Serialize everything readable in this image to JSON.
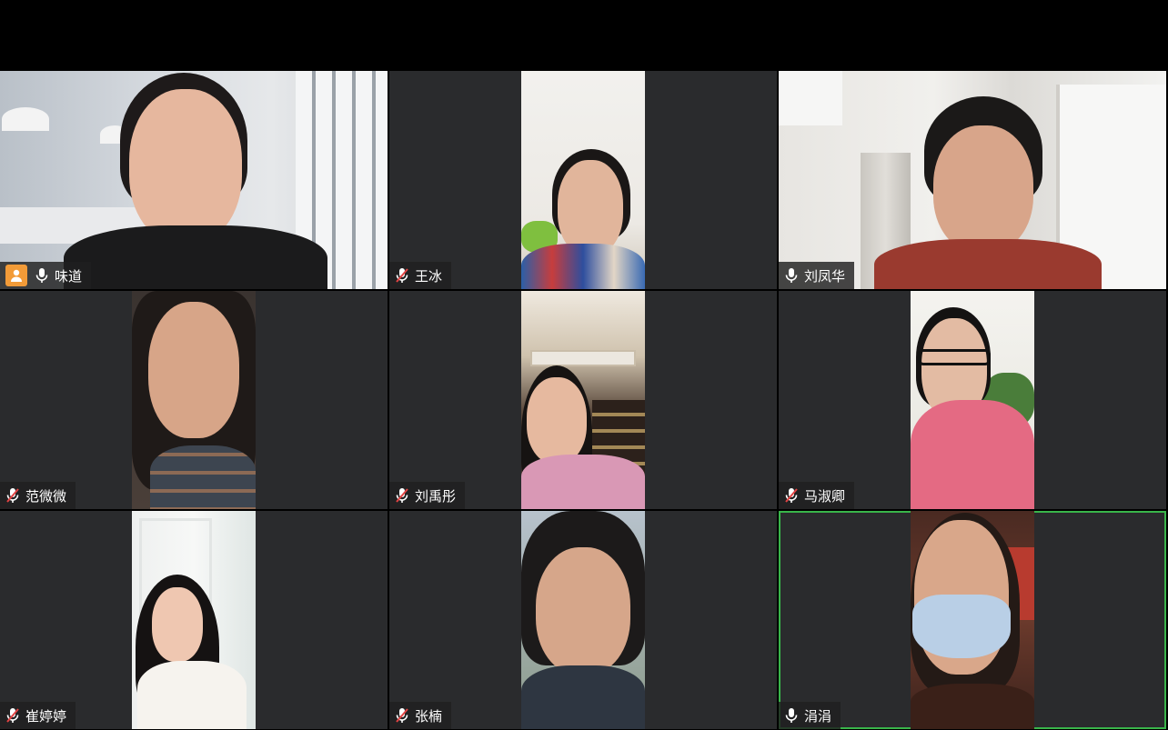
{
  "meeting": {
    "participants": [
      {
        "name": "味道",
        "muted": false,
        "host": true,
        "active": false
      },
      {
        "name": "王冰",
        "muted": true,
        "host": false,
        "active": false
      },
      {
        "name": "刘凤华",
        "muted": false,
        "host": false,
        "active": false
      },
      {
        "name": "范微微",
        "muted": true,
        "host": false,
        "active": false
      },
      {
        "name": "刘禹彤",
        "muted": true,
        "host": false,
        "active": false
      },
      {
        "name": "马淑卿",
        "muted": true,
        "host": false,
        "active": false
      },
      {
        "name": "崔婷婷",
        "muted": true,
        "host": false,
        "active": false
      },
      {
        "name": "张楠",
        "muted": true,
        "host": false,
        "active": false
      },
      {
        "name": "涓涓",
        "muted": false,
        "host": false,
        "active": true
      }
    ]
  },
  "colors": {
    "active_speaker_border": "#39b54a",
    "host_badge": "#f29b38",
    "tile_background": "#2a2b2d"
  }
}
